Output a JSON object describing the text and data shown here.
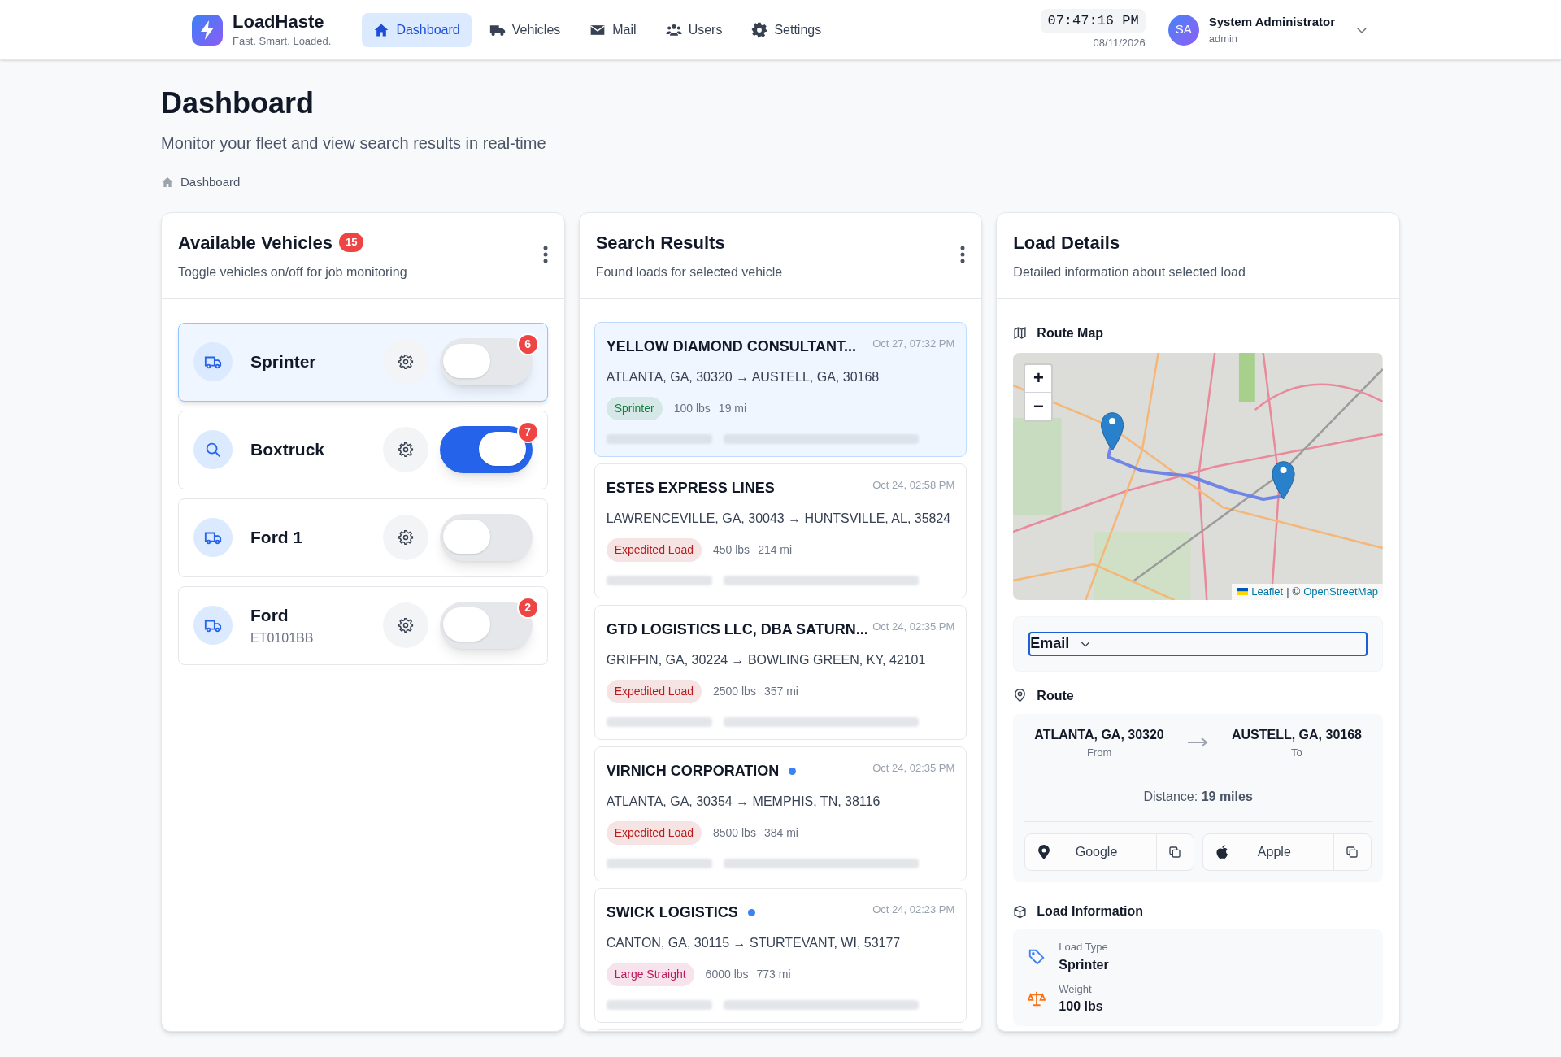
{
  "app": {
    "name": "LoadHaste",
    "tagline": "Fast. Smart. Loaded."
  },
  "nav": [
    {
      "label": "Dashboard",
      "selected": true
    },
    {
      "label": "Vehicles",
      "selected": false
    },
    {
      "label": "Mail",
      "selected": false
    },
    {
      "label": "Users",
      "selected": false
    },
    {
      "label": "Settings",
      "selected": false
    }
  ],
  "clock": {
    "time": "07:47:16 PM",
    "date": "08/11/2026"
  },
  "user": {
    "initials": "SA",
    "name": "System Administrator",
    "role": "admin"
  },
  "page": {
    "title": "Dashboard",
    "subtitle": "Monitor your fleet and view search results in real-time",
    "breadcrumb": "Dashboard"
  },
  "vehicles_panel": {
    "title": "Available Vehicles",
    "count": "15",
    "subtitle": "Toggle vehicles on/off for job monitoring",
    "vehicles": [
      {
        "name": "Sprinter",
        "selected": true,
        "on": false,
        "badge": "6"
      },
      {
        "name": "Boxtruck",
        "selected": false,
        "on": true,
        "badge": "7"
      },
      {
        "name": "Ford 1",
        "selected": false,
        "on": false
      },
      {
        "name": "Ford",
        "plate": "ET0101BB",
        "selected": false,
        "on": false,
        "badge": "2"
      }
    ]
  },
  "results_panel": {
    "title": "Search Results",
    "subtitle": "Found loads for selected vehicle",
    "loads": [
      {
        "company": "YELLOW DIAMOND CONSULTANT...",
        "time": "Oct 27, 07:32 PM",
        "route": "ATLANTA, GA, 30320 → AUSTELL, GA, 30168",
        "tag": {
          "label": "Sprinter",
          "color": "#15803d"
        },
        "weight": "100 lbs",
        "distance": "19 mi",
        "selected": true,
        "unread": false
      },
      {
        "company": "ESTES EXPRESS LINES",
        "time": "Oct 24, 02:58 PM",
        "route": "LAWRENCEVILLE, GA, 30043 → HUNTSVILLE, AL, 35824",
        "tag": {
          "label": "Expedited Load",
          "color": "#b91c1c"
        },
        "weight": "450 lbs",
        "distance": "214 mi",
        "selected": false,
        "unread": false
      },
      {
        "company": "GTD LOGISTICS LLC, DBA SATURN...",
        "time": "Oct 24, 02:35 PM",
        "route": "GRIFFIN, GA, 30224 → BOWLING GREEN, KY, 42101",
        "tag": {
          "label": "Expedited Load",
          "color": "#b91c1c"
        },
        "weight": "2500 lbs",
        "distance": "357 mi",
        "selected": false,
        "unread": false
      },
      {
        "company": "VIRNICH CORPORATION",
        "time": "Oct 24, 02:35 PM",
        "route": "ATLANTA, GA, 30354 → MEMPHIS, TN, 38116",
        "tag": {
          "label": "Expedited Load",
          "color": "#b91c1c"
        },
        "weight": "8500 lbs",
        "distance": "384 mi",
        "selected": false,
        "unread": true
      },
      {
        "company": "SWICK LOGISTICS",
        "time": "Oct 24, 02:23 PM",
        "route": "CANTON, GA, 30115 → STURTEVANT, WI, 53177",
        "tag": {
          "label": "Large Straight",
          "color": "#be185d"
        },
        "weight": "6000 lbs",
        "distance": "773 mi",
        "selected": false,
        "unread": true
      }
    ]
  },
  "details_panel": {
    "title": "Load Details",
    "subtitle": "Detailed information about selected load",
    "map": {
      "heading": "Route Map",
      "zoom_in": "+",
      "zoom_out": "−",
      "attribution_link": "Leaflet",
      "attribution_sep": "|",
      "attribution_text": "©",
      "attribution_osm": "OpenStreetMap"
    },
    "contact_method": "Email",
    "route": {
      "heading": "Route",
      "from": "ATLANTA, GA, 30320",
      "from_label": "From",
      "to": "AUSTELL, GA, 30168",
      "to_label": "To",
      "distance": "Distance: **19 miles**",
      "buttons": [
        "Google",
        "Apple"
      ]
    },
    "load_info": {
      "heading": "Load Information",
      "items": [
        {
          "label": "Load Type",
          "value": "Sprinter"
        },
        {
          "label": "Weight",
          "value": "100 lbs"
        }
      ]
    }
  }
}
